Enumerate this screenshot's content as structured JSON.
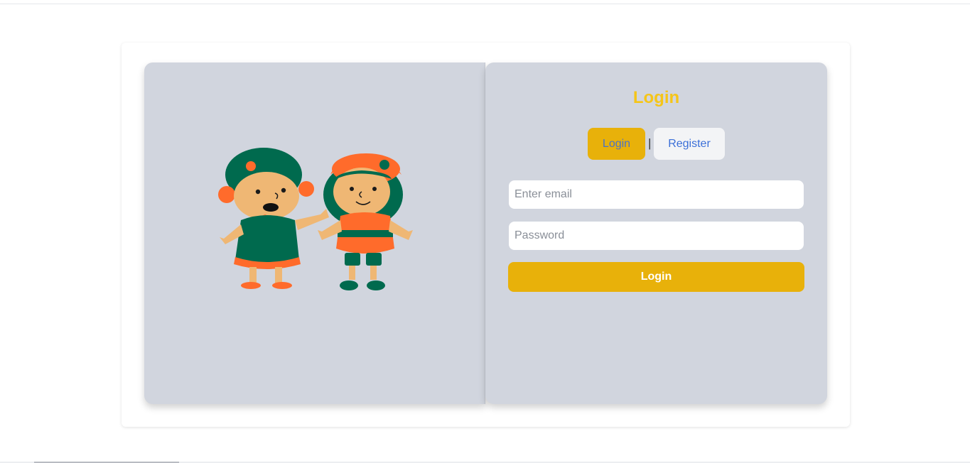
{
  "illustration": {
    "icon": "two-kids-illustration",
    "colors": {
      "green": "#006a4e",
      "orange": "#ff6b2b",
      "skin": "#efb774"
    }
  },
  "form": {
    "title": "Login",
    "tabs": {
      "login_label": "Login",
      "separator": "|",
      "register_label": "Register",
      "active": "Login"
    },
    "email": {
      "placeholder": "Enter email",
      "value": ""
    },
    "password": {
      "placeholder": "Password",
      "value": ""
    },
    "submit_label": "Login"
  },
  "colors": {
    "panel_bg": "#d1d5de",
    "accent": "#e8b10a",
    "title": "#f5c518",
    "link_blue": "#3b6fd8"
  }
}
